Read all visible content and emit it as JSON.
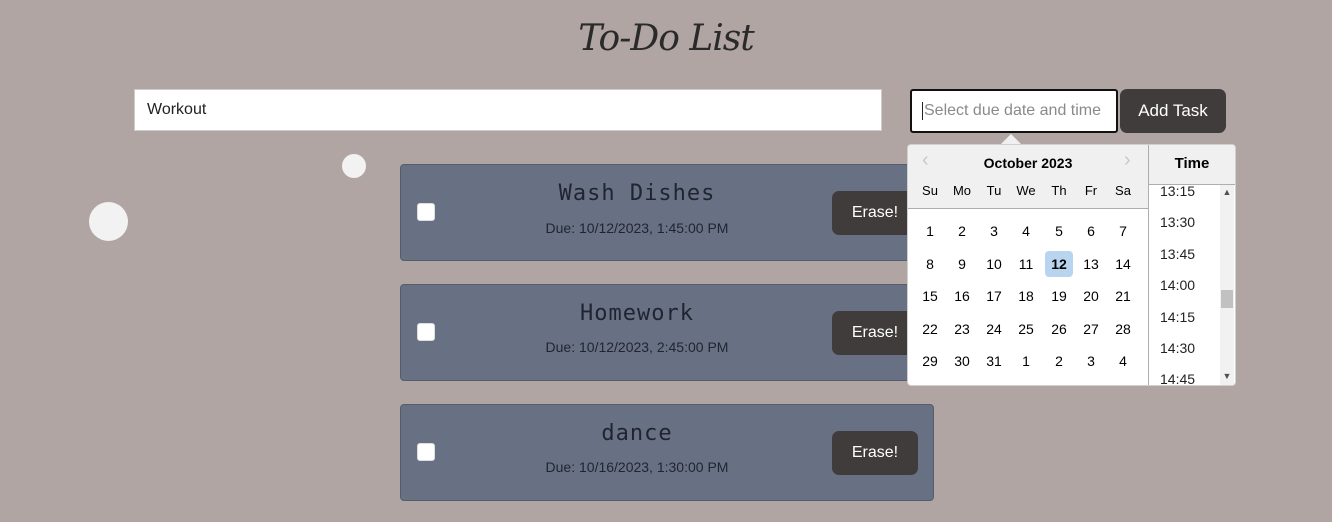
{
  "app": {
    "title": "To-Do List"
  },
  "form": {
    "task_value": "Workout",
    "date_placeholder": "Select due date and time",
    "add_label": "Add Task"
  },
  "tasks": [
    {
      "name": "Wash Dishes",
      "due": "Due: 10/12/2023, 1:45:00 PM",
      "erase": "Erase!"
    },
    {
      "name": "Homework",
      "due": "Due: 10/12/2023, 2:45:00 PM",
      "erase": "Erase!"
    },
    {
      "name": "dance",
      "due": "Due: 10/16/2023, 1:30:00 PM",
      "erase": "Erase!"
    }
  ],
  "datepicker": {
    "month": "October 2023",
    "prev_icon": "chevron-left-icon",
    "next_icon": "chevron-right-icon",
    "weekdays": [
      "Su",
      "Mo",
      "Tu",
      "We",
      "Th",
      "Fr",
      "Sa"
    ],
    "weeks": [
      [
        "1",
        "2",
        "3",
        "4",
        "5",
        "6",
        "7"
      ],
      [
        "8",
        "9",
        "10",
        "11",
        "12",
        "13",
        "14"
      ],
      [
        "15",
        "16",
        "17",
        "18",
        "19",
        "20",
        "21"
      ],
      [
        "22",
        "23",
        "24",
        "25",
        "26",
        "27",
        "28"
      ],
      [
        "29",
        "30",
        "31",
        "1",
        "2",
        "3",
        "4"
      ]
    ],
    "selected_day": "12",
    "time_header": "Time",
    "times": [
      "13:15",
      "13:30",
      "13:45",
      "14:00",
      "14:15",
      "14:30",
      "14:45"
    ]
  },
  "colors": {
    "background": "#b1a5a3",
    "card": "#687183",
    "button": "#3f3c3b",
    "selected_day": "#b8d4ee"
  }
}
